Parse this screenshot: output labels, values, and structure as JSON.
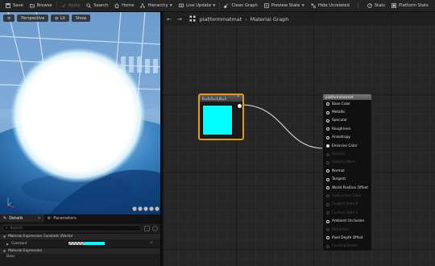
{
  "toolbar": {
    "save": "Save",
    "browse": "Browse",
    "apply": "Apply",
    "search": "Search",
    "home": "Home",
    "hierarchy": "Hierarchy",
    "live_update": "Live Update",
    "clean_graph": "Clean Graph",
    "preview_state": "Preview State",
    "hide_unrelated": "Hide Unrelated",
    "stats": "Stats",
    "platform_stats": "Platform Stats"
  },
  "viewport": {
    "perspective": "Perspective",
    "lit": "Lit",
    "show": "Show"
  },
  "details": {
    "tab_details": "Details",
    "tab_parameters": "Parameters",
    "search_placeholder": "Search",
    "section_constant": "Material Expression Constant 3Vector",
    "prop_constant": "Constant",
    "section_expression": "Material Expression",
    "prop_desc": "Desc"
  },
  "graph": {
    "breadcrumb_asset": "platformmatmat",
    "breadcrumb_graph": "Material Graph",
    "constant_node_title": "R=0,G=1,B=1",
    "material_node_title": "platformmatmat",
    "pins": [
      {
        "label": "Base Color",
        "enabled": true
      },
      {
        "label": "Metallic",
        "enabled": true
      },
      {
        "label": "Specular",
        "enabled": true
      },
      {
        "label": "Roughness",
        "enabled": true
      },
      {
        "label": "Anisotropy",
        "enabled": true
      },
      {
        "label": "Emissive Color",
        "enabled": true,
        "connected": true
      },
      {
        "label": "Opacity",
        "enabled": false
      },
      {
        "label": "Opacity Mask",
        "enabled": false
      },
      {
        "label": "Normal",
        "enabled": true
      },
      {
        "label": "Tangent",
        "enabled": true
      },
      {
        "label": "World Position Offset",
        "enabled": true
      },
      {
        "label": "Subsurface Color",
        "enabled": false
      },
      {
        "label": "Custom Data 0",
        "enabled": false
      },
      {
        "label": "Custom Data 1",
        "enabled": false
      },
      {
        "label": "Ambient Occlusion",
        "enabled": true
      },
      {
        "label": "Refraction",
        "enabled": false
      },
      {
        "label": "Pixel Depth Offset",
        "enabled": true
      },
      {
        "label": "Shading Model",
        "enabled": false
      }
    ]
  },
  "colors": {
    "accent_cyan": "#00ffff",
    "selection_orange": "#e39b16"
  }
}
